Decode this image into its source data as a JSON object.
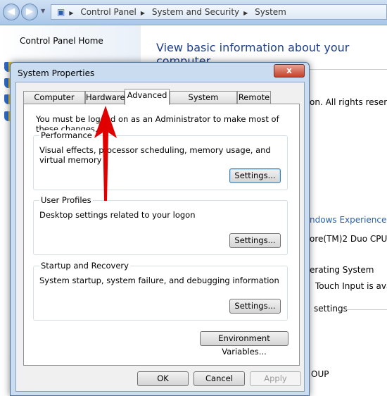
{
  "address_bar": {
    "breadcrumbs": [
      "Control Panel",
      "System and Security",
      "System"
    ]
  },
  "sidebar": {
    "home": "Control Panel Home"
  },
  "main": {
    "heading": "View basic information about your computer",
    "partial_lines": [
      "on.  All rights reserve",
      "ndows Experience Inc",
      "ore(TM)2 Duo CPU",
      "erating System",
      "Touch Input is avail",
      "settings",
      "OUP"
    ]
  },
  "dialog": {
    "title": "System Properties",
    "close": "x",
    "tabs": [
      "Computer Name",
      "Hardware",
      "Advanced",
      "System Protection",
      "Remote"
    ],
    "active_tab": "Advanced",
    "notice": "You must be logged on as an Administrator to make most of these changes.",
    "groups": [
      {
        "label": "Performance",
        "desc": "Visual effects, processor scheduling, memory usage, and virtual memory",
        "button": "Settings..."
      },
      {
        "label": "User Profiles",
        "desc": "Desktop settings related to your logon",
        "button": "Settings..."
      },
      {
        "label": "Startup and Recovery",
        "desc": "System startup, system failure, and debugging information",
        "button": "Settings..."
      }
    ],
    "env_button": "Environment Variables...",
    "ok": "OK",
    "cancel": "Cancel",
    "apply": "Apply"
  },
  "annotation": {
    "arrow_color": "#e00000"
  }
}
